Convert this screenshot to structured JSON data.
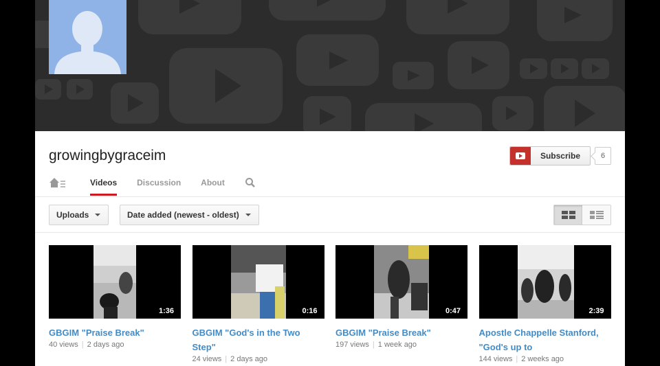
{
  "channel": {
    "name": "growingbygraceim",
    "subscribe_label": "Subscribe",
    "subscriber_count": "6"
  },
  "tabs": [
    {
      "id": "home",
      "icon": "home-icon"
    },
    {
      "id": "videos",
      "label": "Videos",
      "active": true
    },
    {
      "id": "discussion",
      "label": "Discussion"
    },
    {
      "id": "about",
      "label": "About"
    },
    {
      "id": "search",
      "icon": "search-icon"
    }
  ],
  "filters": {
    "uploads_label": "Uploads",
    "sort_label": "Date added (newest - oldest)"
  },
  "view_modes": [
    "grid-view-icon",
    "list-view-icon"
  ],
  "videos": [
    {
      "title": "GBGIM \"Praise Break\"",
      "views": "40 views",
      "age": "2 days ago",
      "duration": "1:36"
    },
    {
      "title": "GBGIM \"God's in the Two Step\"",
      "views": "24 views",
      "age": "2 days ago",
      "duration": "0:16"
    },
    {
      "title": "GBGIM \"Praise Break\"",
      "views": "197 views",
      "age": "1 week ago",
      "duration": "0:47"
    },
    {
      "title": "Apostle Chappelle Stanford, \"God's up to",
      "views": "144 views",
      "age": "2 weeks ago",
      "duration": "2:39"
    }
  ],
  "colors": {
    "accent": "#cc181e",
    "link": "#438bc5",
    "banner_bg": "#2c2c2c",
    "avatar_bg": "#8fb3e6"
  }
}
